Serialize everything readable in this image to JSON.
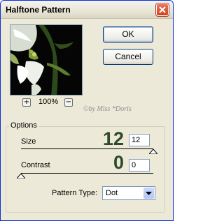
{
  "window": {
    "title": "Halftone Pattern"
  },
  "buttons": {
    "ok": "OK",
    "cancel": "Cancel"
  },
  "preview": {
    "zoom_level": "100%",
    "zoom_in": "+",
    "zoom_out": "−"
  },
  "watermark": "©by Miss *Doris",
  "options": {
    "group_label": "Options",
    "size": {
      "label": "Size",
      "big_value": "12",
      "input_value": "12",
      "slider_fraction": 1.0
    },
    "contrast": {
      "label": "Contrast",
      "big_value": "0",
      "input_value": "0",
      "slider_fraction": 0.0
    },
    "pattern_type": {
      "label": "Pattern Type:",
      "selected": "Dot"
    }
  },
  "colors": {
    "title_bar_border": "#0831d9",
    "close_button": "#d3401b",
    "big_value_color": "#2f4a2b"
  }
}
